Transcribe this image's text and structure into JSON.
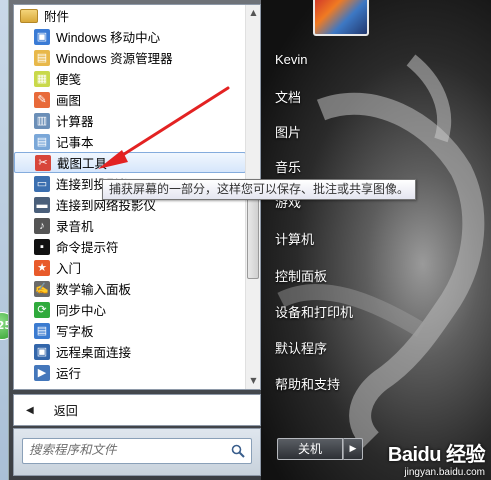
{
  "desktop": {
    "badge": "25"
  },
  "program_list": {
    "folder": "附件",
    "items": [
      {
        "label": "Windows 移动中心",
        "icon": "mobility-center-icon",
        "color": "#3a7bd5"
      },
      {
        "label": "Windows 资源管理器",
        "icon": "explorer-icon",
        "color": "#e8b84a"
      },
      {
        "label": "便笺",
        "icon": "sticky-notes-icon",
        "color": "#c9d94a"
      },
      {
        "label": "画图",
        "icon": "paint-icon",
        "color": "#e86a3a"
      },
      {
        "label": "计算器",
        "icon": "calculator-icon",
        "color": "#6b8fb8"
      },
      {
        "label": "记事本",
        "icon": "notepad-icon",
        "color": "#7aa7d8"
      },
      {
        "label": "截图工具",
        "icon": "snipping-tool-icon",
        "color": "#d8463a"
      },
      {
        "label": "连接到投影仪",
        "icon": "projector-icon",
        "color": "#3b6fb0"
      },
      {
        "label": "连接到网络投影仪",
        "icon": "network-projector-icon",
        "color": "#4a5f7a"
      },
      {
        "label": "录音机",
        "icon": "sound-recorder-icon",
        "color": "#555555"
      },
      {
        "label": "命令提示符",
        "icon": "command-prompt-icon",
        "color": "#111111"
      },
      {
        "label": "入门",
        "icon": "getting-started-icon",
        "color": "#e85a2a"
      },
      {
        "label": "数学输入面板",
        "icon": "math-input-icon",
        "color": "#6a6a6a"
      },
      {
        "label": "同步中心",
        "icon": "sync-center-icon",
        "color": "#2faa3c"
      },
      {
        "label": "写字板",
        "icon": "wordpad-icon",
        "color": "#3b7bd0"
      },
      {
        "label": "远程桌面连接",
        "icon": "remote-desktop-icon",
        "color": "#3366aa"
      },
      {
        "label": "运行",
        "icon": "run-icon",
        "color": "#4477bb"
      }
    ],
    "back": "返回",
    "search_placeholder": "搜索程序和文件"
  },
  "tooltip": "捕获屏幕的一部分，这样您可以保存、批注或共享图像。",
  "right_pane": {
    "items": [
      "Kevin",
      "文档",
      "图片",
      "音乐",
      "游戏",
      "计算机",
      "控制面板",
      "设备和打印机",
      "默认程序",
      "帮助和支持"
    ],
    "shutdown": "关机"
  },
  "watermark": {
    "logo": "Baidu 经验",
    "url": "jingyan.baidu.com"
  },
  "colors": {
    "hover_bg": "#d6e6fb",
    "hover_border": "#84acdd",
    "annotation": "#e32222"
  }
}
